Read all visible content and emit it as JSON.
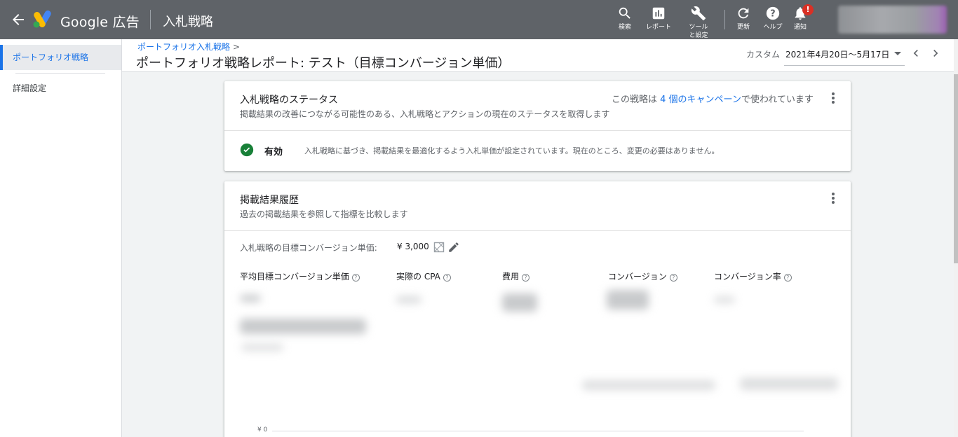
{
  "topbar": {
    "brand": "Google 広告",
    "app_title": "入札戦略",
    "tools": [
      {
        "label": "検索",
        "icon": "search-icon"
      },
      {
        "label": "レポート",
        "icon": "report-icon"
      },
      {
        "label": "ツールと設定",
        "icon": "wrench-icon"
      },
      {
        "label": "更新",
        "icon": "refresh-icon"
      },
      {
        "label": "ヘルプ",
        "icon": "help-icon"
      },
      {
        "label": "通知",
        "icon": "bell-icon"
      }
    ],
    "notification_badge": "!"
  },
  "sidebar": {
    "items": [
      {
        "label": "ポートフォリオ戦略"
      },
      {
        "label": "詳細設定"
      }
    ]
  },
  "header": {
    "breadcrumb": "ポートフォリオ入札戦略",
    "title": "ポートフォリオ戦略レポート: テスト（目標コンバージョン単価）",
    "date_label": "カスタム",
    "date_range": "2021年4月20日～5月17日"
  },
  "status_card": {
    "title": "入札戦略のステータス",
    "subtitle": "掲載結果の改善につながる可能性のある、入札戦略とアクションの現在のステータスを取得します",
    "used_prefix": "この戦略は",
    "used_link": "4 個のキャンペーン",
    "used_suffix": "で使われています",
    "status_label": "有効",
    "status_desc": "入札戦略に基づき、掲載結果を最適化するよう入札単価が設定されています。現在のところ、変更の必要はありません。"
  },
  "history_card": {
    "title": "掲載結果履歴",
    "subtitle": "過去の掲載結果を参照して指標を比較します",
    "target_label": "入札戦略の目標コンバージョン単価:",
    "target_value": "¥ 3,000",
    "metrics": [
      {
        "label": "平均目標コンバージョン単価"
      },
      {
        "label": "実際の CPA"
      },
      {
        "label": "費用"
      },
      {
        "label": "コンバージョン"
      },
      {
        "label": "コンバージョン率"
      }
    ],
    "axis_zero": "¥ 0"
  },
  "colors": {
    "topbar": "#5f6368",
    "accent": "#1a73e8",
    "status_green": "#188038",
    "badge_red": "#d93025"
  }
}
